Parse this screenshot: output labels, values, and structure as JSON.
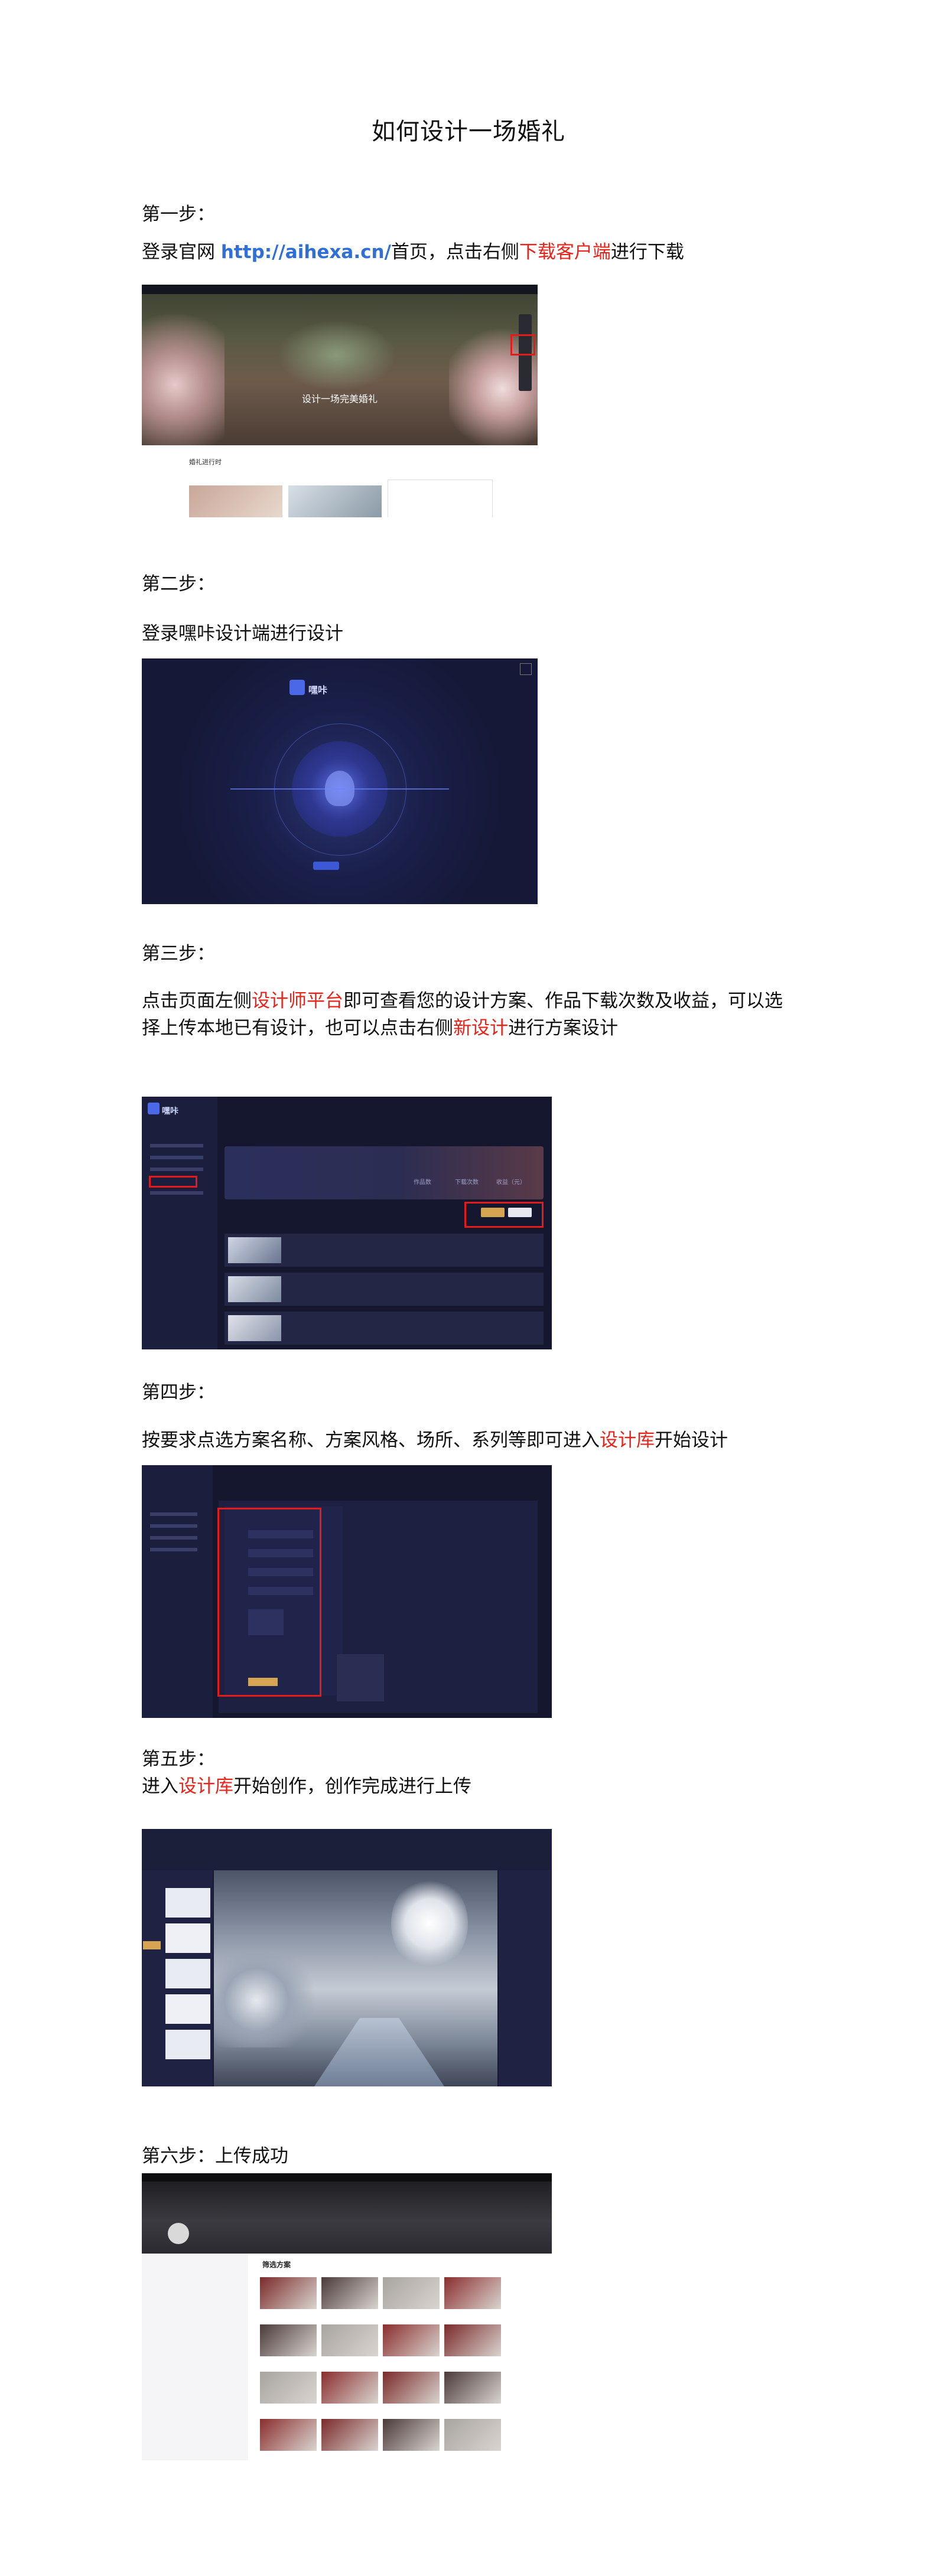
{
  "title": "如何设计一场婚礼",
  "steps": {
    "s1": {
      "heading": "第一步：",
      "pre": "登录官网 ",
      "link": "http://aihexa.cn/",
      "mid": "首页，点击右侧",
      "highlight": "下载客户端",
      "post": "进行下载"
    },
    "s2": {
      "heading": "第二步：",
      "text": "登录嘿咔设计端进行设计"
    },
    "s3": {
      "heading": "第三步：",
      "pre": "点击页面左侧",
      "highlight1": "设计师平台",
      "mid": "即可查看您的设计方案、作品下载次数及收益，可以选",
      "line2_pre": "择上传本地已有设计，也可以点击右侧",
      "highlight2": "新设计",
      "line2_post": "进行方案设计"
    },
    "s4": {
      "heading": "第四步：",
      "pre": "按要求点选方案名称、方案风格、场所、系列等即可进入",
      "highlight": "设计库",
      "post": "开始设计"
    },
    "s5": {
      "heading": "第五步：",
      "pre": "进入",
      "highlight": "设计库",
      "post": "开始创作，创作完成进行上传"
    },
    "s6": {
      "heading": "第六步：上传成功"
    }
  },
  "shot1": {
    "hero_text": "设计一场完美婚礼",
    "section": "婚礼进行时"
  },
  "shot2": {
    "logo": "嘿咔"
  },
  "shot3": {
    "logo": "嘿咔",
    "stats": [
      "作品数",
      "下载次数",
      "收益（元）"
    ]
  },
  "shot6": {
    "section": "筛选方案"
  },
  "colors": {
    "accent_red": "#e8231a",
    "link_blue": "#2f6fd6",
    "app_dark": "#1a1d3a"
  }
}
